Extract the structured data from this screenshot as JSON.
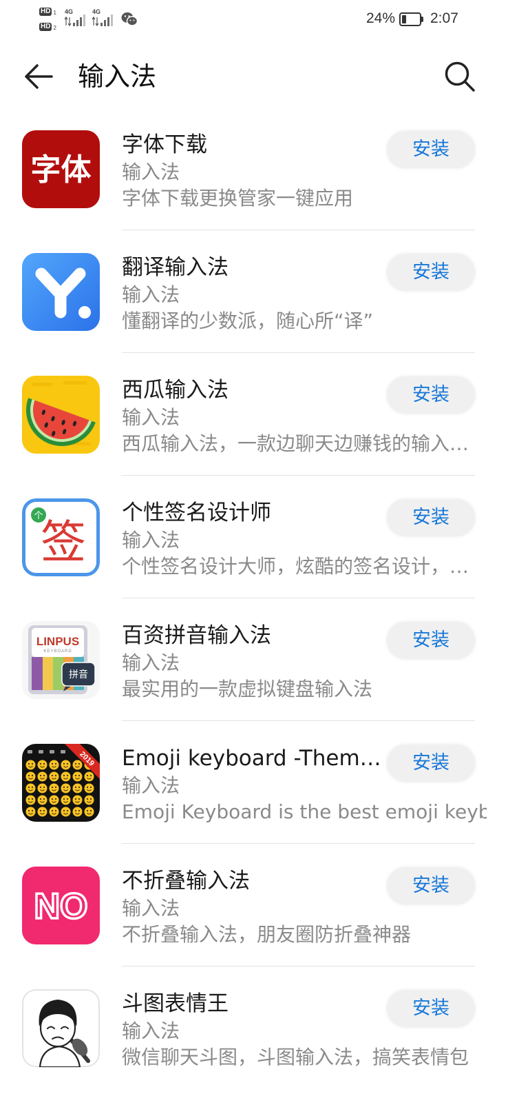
{
  "status_bar": {
    "sim1": {
      "label": "HD",
      "index": "1"
    },
    "sim2": {
      "label": "HD",
      "index": "2"
    },
    "signal1": {
      "network": "4G",
      "icon": "signal-icon"
    },
    "signal2": {
      "network": "4G",
      "icon": "signal-icon"
    },
    "notification_icon": "wechat-icon",
    "battery_percent": "24%",
    "battery_level": 0.24,
    "time": "2:07"
  },
  "header": {
    "back_icon": "back-arrow-icon",
    "title": "输入法",
    "search_icon": "search-icon"
  },
  "apps": [
    {
      "name": "字体下载",
      "category": "输入法",
      "description": "字体下载更换管家一键应用",
      "action": "安装",
      "icon": "ziti-font-app-icon",
      "icon_text": "字体"
    },
    {
      "name": "翻译输入法",
      "category": "输入法",
      "description": "懂翻译的少数派，随心所“译”",
      "action": "安装",
      "icon": "translate-y-app-icon"
    },
    {
      "name": "西瓜输入法",
      "category": "输入法",
      "description": "西瓜输入法，一款边聊天边赚钱的输入…",
      "action": "安装",
      "icon": "watermelon-app-icon"
    },
    {
      "name": "个性签名设计师",
      "category": "输入法",
      "description": "个性签名设计大师，炫酷的签名设计，…",
      "action": "安装",
      "icon": "signature-app-icon",
      "icon_text": "签",
      "badge_text": "个"
    },
    {
      "name": "百资拼音输入法",
      "category": "输入法",
      "description": "最实用的一款虚拟键盘输入法",
      "action": "安装",
      "icon": "linpus-keyboard-app-icon",
      "icon_brand": "LINPUS",
      "icon_caption": "KEYBOARD",
      "icon_bubble": "拼音"
    },
    {
      "name": "Emoji keyboard -Them…",
      "category": "输入法",
      "description": "Emoji Keyboard is the best emoji keybo…",
      "action": "安装",
      "icon": "emoji-keyboard-app-icon",
      "icon_ribbon": "2019"
    },
    {
      "name": "不折叠输入法",
      "category": "输入法",
      "description": "不折叠输入法，朋友圈防折叠神器",
      "action": "安装",
      "icon": "no-fold-app-icon",
      "icon_text": "NO"
    },
    {
      "name": "斗图表情王",
      "category": "输入法",
      "description": "微信聊天斗图，斗图输入法，搞笑表情包",
      "action": "安装",
      "icon": "meme-face-app-icon"
    }
  ],
  "colors": {
    "accent": "#1677d9",
    "title_text": "#1a1a1a",
    "secondary_text": "#8a8a8a",
    "button_bg": "#f0f0f0",
    "divider": "#e2e2e2"
  }
}
